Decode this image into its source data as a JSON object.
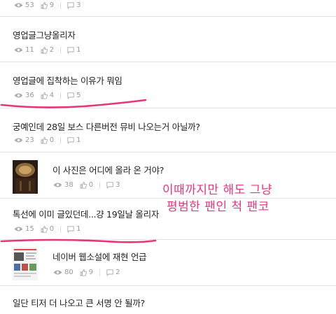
{
  "posts": [
    {
      "title": "",
      "views": "53",
      "likes": "9",
      "comments": "3"
    },
    {
      "title": "영업글그냥올리자",
      "views": "11",
      "likes": "2",
      "comments": "1"
    },
    {
      "title": "영업글에 집착하는 이유가 뭐임",
      "views": "36",
      "likes": "4",
      "comments": "5"
    },
    {
      "title": "궁예인데 28일 보스 다른버전 뮤비 나오는거 아닐까?",
      "views": "23",
      "likes": "0",
      "comments": "1"
    },
    {
      "title": "이 사진은 어디에 올라 온 거야?",
      "views": "38",
      "likes": "0",
      "comments": "3"
    },
    {
      "title": "톡선에 이미 글있던데...걍 19일날 올리자",
      "views": "15",
      "likes": "0",
      "comments": "1"
    },
    {
      "title": "네이버 웹소설에 재현 언급",
      "views": "80",
      "likes": "9",
      "comments": "2"
    },
    {
      "title": "일단 티저 더 나오고 큰 서명 안 될까?"
    }
  ],
  "annotation": {
    "line1": "이때까지만 해도 그냥",
    "line2": "평범한 팬인 척 팬코",
    "color": "#e8357a"
  },
  "icons": {
    "views": "eye-icon",
    "likes": "like-icon",
    "comments": "comment-icon"
  }
}
